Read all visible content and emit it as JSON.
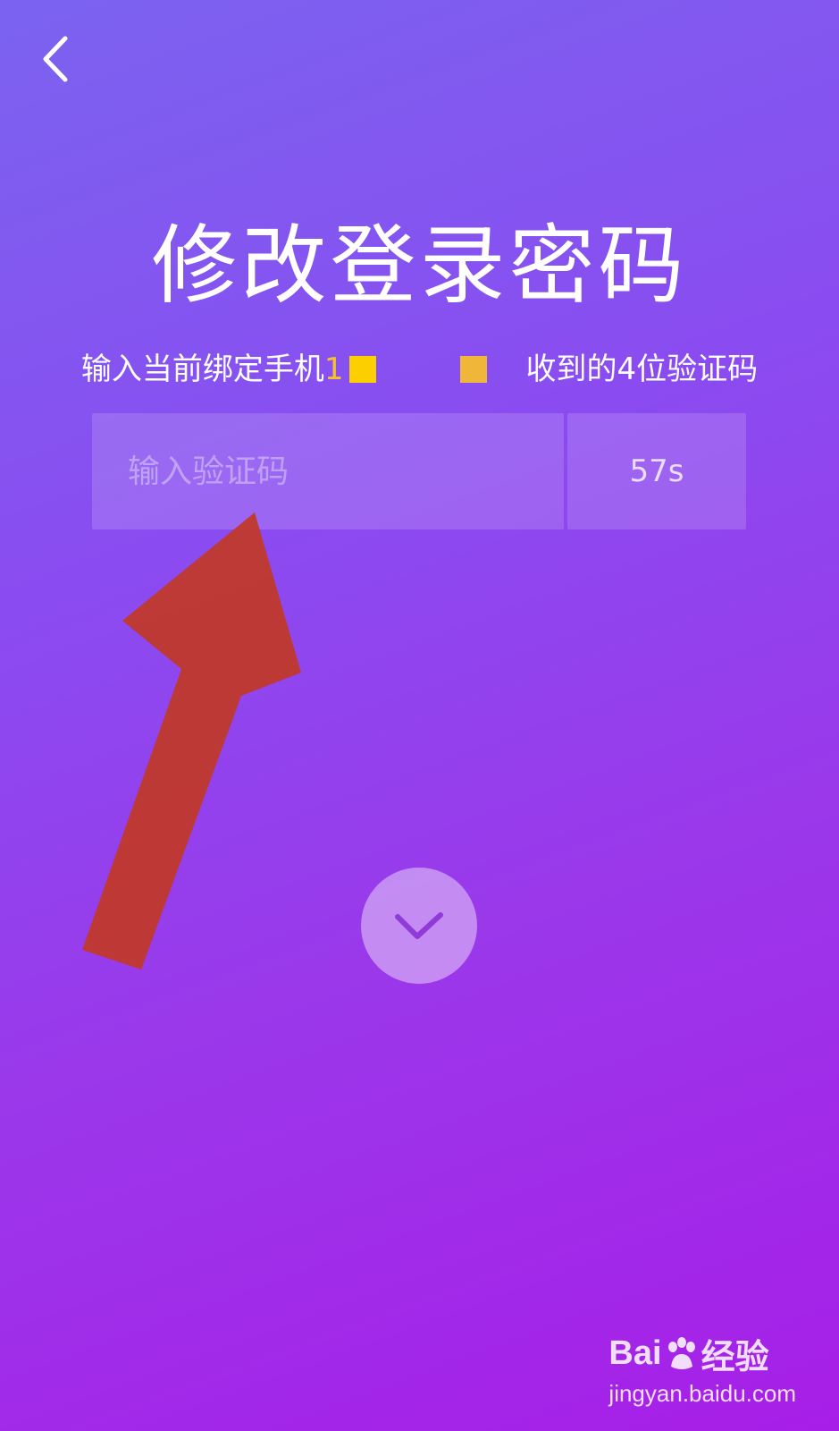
{
  "header": {
    "back_icon": "chevron-left-icon"
  },
  "page": {
    "title": "修改登录密码",
    "subtitle_before": "输入当前绑定手机",
    "subtitle_phone_visible": "1",
    "subtitle_after": "收到的4位验证码"
  },
  "verify": {
    "code_placeholder": "输入验证码",
    "code_value": "",
    "countdown": "57s"
  },
  "confirm": {
    "icon": "checkmark-icon"
  },
  "watermark": {
    "brand": "Bai",
    "brand_suffix": "经验",
    "url": "jingyan.baidu.com"
  },
  "colors": {
    "accent_phone": "#f6c22b",
    "annotation_arrow": "#c0392b"
  }
}
